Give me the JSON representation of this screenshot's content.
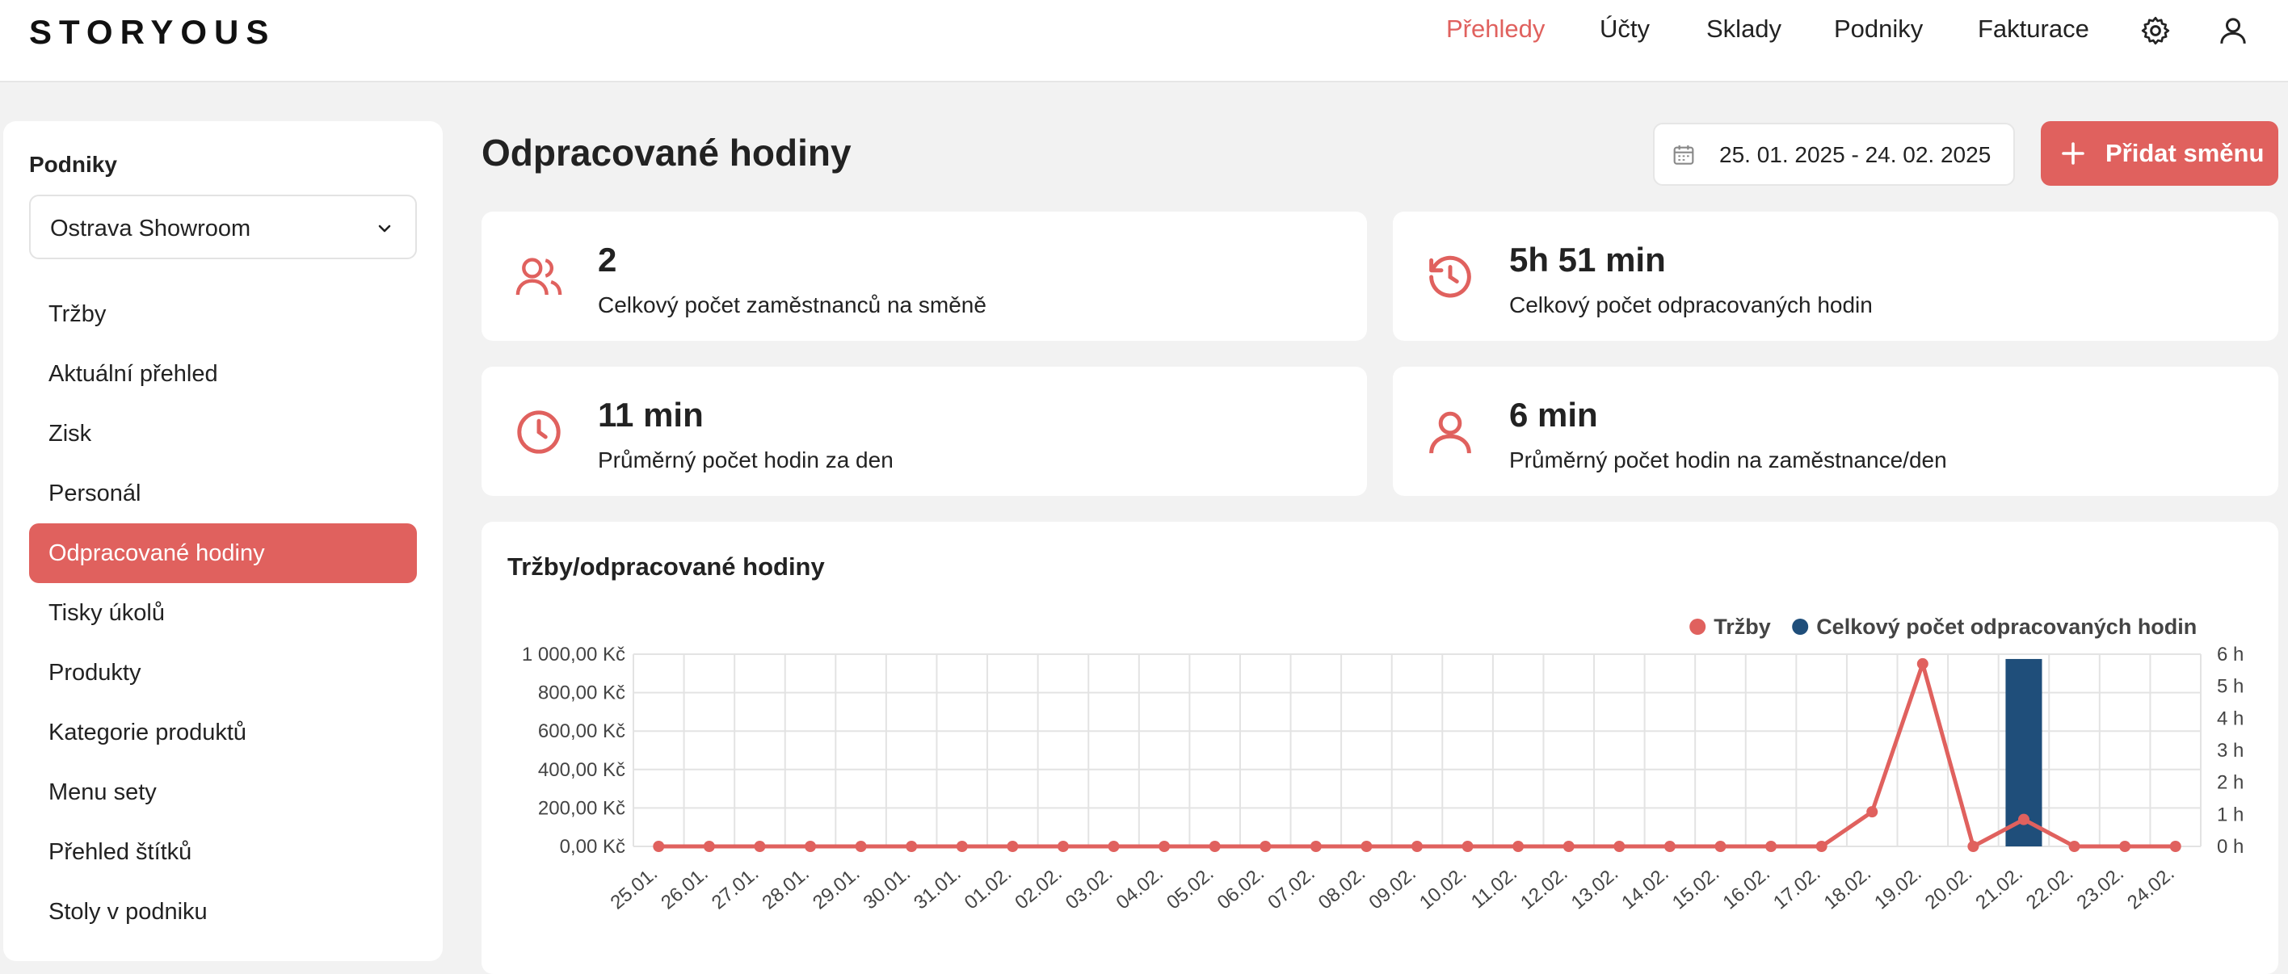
{
  "app": {
    "logo": "STORYOUS"
  },
  "nav": {
    "items": [
      {
        "label": "Přehledy",
        "active": true
      },
      {
        "label": "Účty"
      },
      {
        "label": "Sklady"
      },
      {
        "label": "Podniky"
      },
      {
        "label": "Fakturace"
      }
    ],
    "icons": [
      "gear-icon",
      "user-icon"
    ]
  },
  "sidebar": {
    "title": "Podniky",
    "select_value": "Ostrava Showroom",
    "items": [
      {
        "label": "Tržby"
      },
      {
        "label": "Aktuální přehled"
      },
      {
        "label": "Zisk"
      },
      {
        "label": "Personál"
      },
      {
        "label": "Odpracované hodiny",
        "active": true
      },
      {
        "label": "Tisky úkolů"
      },
      {
        "label": "Produkty"
      },
      {
        "label": "Kategorie produktů"
      },
      {
        "label": "Menu sety"
      },
      {
        "label": "Přehled štítků"
      },
      {
        "label": "Stoly v podniku"
      }
    ]
  },
  "main": {
    "title": "Odpracované hodiny",
    "date_range": "25. 01. 2025 - 24. 02. 2025",
    "add_button": "Přidat směnu",
    "stats": [
      {
        "value": "2",
        "label": "Celkový počet zaměstnanců na směně",
        "icon": "users-icon"
      },
      {
        "value": "5h 51 min",
        "label": "Celkový počet odpracovaných hodin",
        "icon": "history-icon"
      },
      {
        "value": "11 min",
        "label": "Průměrný počet hodin za den",
        "icon": "clock-icon"
      },
      {
        "value": "6 min",
        "label": "Průměrný počet hodin na zaměstnance/den",
        "icon": "person-icon"
      }
    ]
  },
  "colors": {
    "accent": "#e0615e",
    "bar": "#1f4e7a"
  },
  "chart_data": {
    "type": "bar",
    "title": "Tržby/odpracované hodiny",
    "legend_position": "top-right",
    "grid": true,
    "categories": [
      "25.01.",
      "26.01.",
      "27.01.",
      "28.01.",
      "29.01.",
      "30.01.",
      "31.01.",
      "01.02.",
      "02.02.",
      "03.02.",
      "04.02.",
      "05.02.",
      "06.02.",
      "07.02.",
      "08.02.",
      "09.02.",
      "10.02.",
      "11.02.",
      "12.02.",
      "13.02.",
      "14.02.",
      "15.02.",
      "16.02.",
      "17.02.",
      "18.02.",
      "19.02.",
      "20.02.",
      "21.02.",
      "22.02.",
      "23.02.",
      "24.02."
    ],
    "y_left": {
      "ticks": [
        "0,00 Kč",
        "200,00 Kč",
        "400,00 Kč",
        "600,00 Kč",
        "800,00 Kč",
        "1 000,00 Kč"
      ],
      "range": [
        0,
        1000
      ]
    },
    "y_right": {
      "ticks": [
        "0 h",
        "1 h",
        "2 h",
        "3 h",
        "4 h",
        "5 h",
        "6 h"
      ],
      "range": [
        0,
        6
      ]
    },
    "series": [
      {
        "name": "Tržby",
        "kind": "line",
        "axis": "left",
        "color": "#e0615e",
        "values": [
          0,
          0,
          0,
          0,
          0,
          0,
          0,
          0,
          0,
          0,
          0,
          0,
          0,
          0,
          0,
          0,
          0,
          0,
          0,
          0,
          0,
          0,
          0,
          0,
          180,
          950,
          0,
          140,
          0,
          0,
          0
        ]
      },
      {
        "name": "Celkový počet odpracovaných hodin",
        "kind": "bar",
        "axis": "right",
        "color": "#1f4e7a",
        "values": [
          0,
          0,
          0,
          0,
          0,
          0,
          0,
          0,
          0,
          0,
          0,
          0,
          0,
          0,
          0,
          0,
          0,
          0,
          0,
          0,
          0,
          0,
          0,
          0,
          0,
          0,
          0,
          5.85,
          0,
          0,
          0
        ]
      }
    ]
  }
}
